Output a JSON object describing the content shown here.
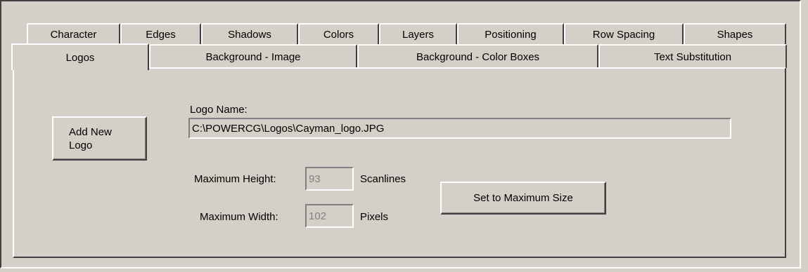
{
  "tabs_back": [
    "Character",
    "Edges",
    "Shadows",
    "Colors",
    "Layers",
    "Positioning",
    "Row Spacing",
    "Shapes"
  ],
  "tabs_front": [
    "Logos",
    "Background - Image",
    "Background - Color Boxes",
    "Text Substitution"
  ],
  "active_tab": "Logos",
  "add_logo_button": "Add New\nLogo",
  "logo_name_label": "Logo Name:",
  "logo_name_value": "C:\\POWERCG\\Logos\\Cayman_logo.JPG",
  "max_height_label": "Maximum Height:",
  "max_height_value": "93",
  "max_height_unit": "Scanlines",
  "max_width_label": "Maximum Width:",
  "max_width_value": "102",
  "max_width_unit": "Pixels",
  "set_max_button": "Set to Maximum Size"
}
